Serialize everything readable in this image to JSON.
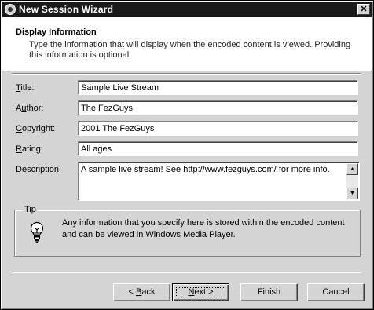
{
  "window": {
    "title": "New Session Wizard",
    "close_glyph": "✕"
  },
  "header": {
    "title": "Display Information",
    "description": "Type the information that will display when the encoded content is viewed. Providing this information is optional."
  },
  "fields": {
    "title": {
      "label_pre": "",
      "label_key": "T",
      "label_post": "itle:",
      "value": "Sample Live Stream"
    },
    "author": {
      "label_pre": "A",
      "label_key": "u",
      "label_post": "thor:",
      "value": "The FezGuys"
    },
    "copyright": {
      "label_pre": "",
      "label_key": "C",
      "label_post": "opyright:",
      "value": "2001 The FezGuys"
    },
    "rating": {
      "label_pre": "",
      "label_key": "R",
      "label_post": "ating:",
      "value": "All ages"
    },
    "description": {
      "label_pre": "D",
      "label_key": "e",
      "label_post": "scription:",
      "value": "A sample live stream! See http://www.fezguys.com/ for more info."
    }
  },
  "tip": {
    "legend": "Tip",
    "icon": "bulb-icon",
    "text": "Any information that you specify here is stored within the encoded content and can be viewed in Windows Media Player."
  },
  "buttons": {
    "back": {
      "prefix": "< ",
      "key": "B",
      "rest": "ack"
    },
    "next": {
      "prefix": "",
      "key": "N",
      "rest": "ext >"
    },
    "finish": "Finish",
    "cancel": "Cancel"
  },
  "colors": {
    "title_bar": "#1a1a1a",
    "dialog_face": "#d4d4d4",
    "header_bg": "#ffffff"
  }
}
